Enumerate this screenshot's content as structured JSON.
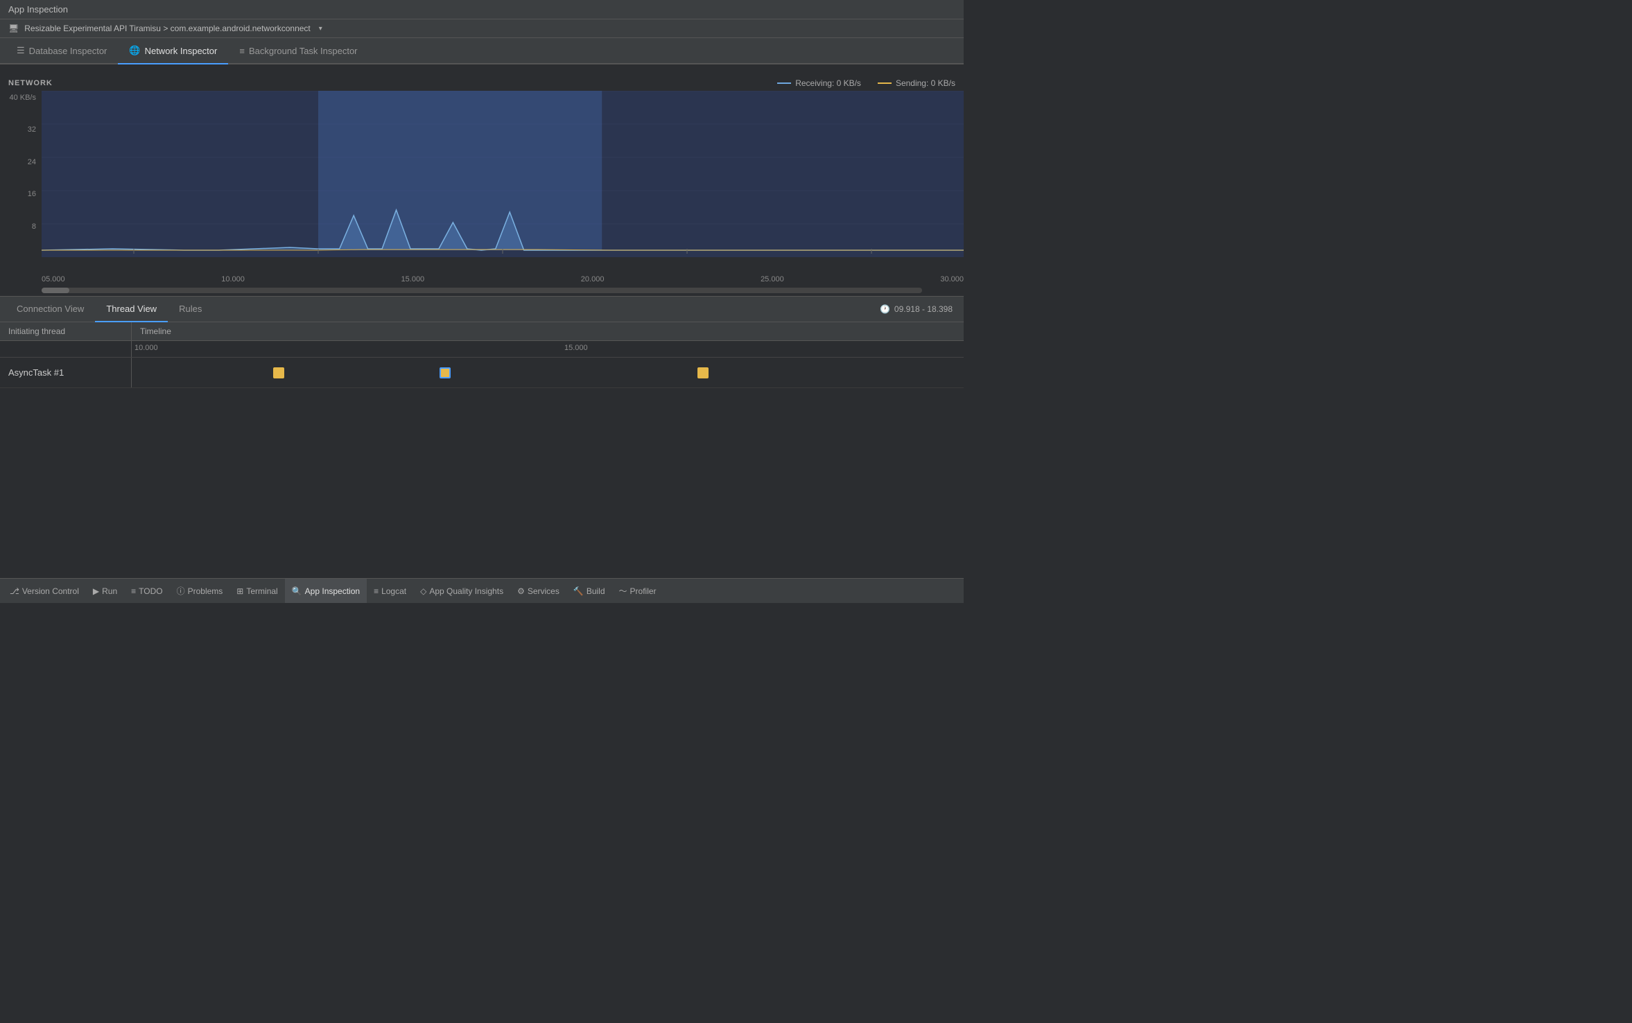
{
  "titleBar": {
    "label": "App Inspection"
  },
  "deviceBar": {
    "icon": "📱",
    "text": "Resizable Experimental API Tiramisu > com.example.android.networkconnect",
    "dropdown": "▾"
  },
  "inspectorTabs": [
    {
      "id": "database",
      "label": "Database Inspector",
      "icon": "☰",
      "active": false
    },
    {
      "id": "network",
      "label": "Network Inspector",
      "icon": "🌐",
      "active": true
    },
    {
      "id": "background",
      "label": "Background Task Inspector",
      "icon": "≡",
      "active": false
    }
  ],
  "chart": {
    "title": "NETWORK",
    "yAxisLabel": "40 KB/s",
    "yLabels": [
      "40 KB/s",
      "32",
      "24",
      "16",
      "8",
      ""
    ],
    "legend": {
      "receiving": "Receiving: 0 KB/s",
      "sending": "Sending: 0 KB/s"
    },
    "xLabels": [
      "05.000",
      "10.000",
      "15.000",
      "20.000",
      "25.000",
      "30.000"
    ],
    "selectedRange": {
      "start": "09.918",
      "end": "18.398"
    }
  },
  "viewTabs": [
    {
      "id": "connection",
      "label": "Connection View",
      "active": false
    },
    {
      "id": "thread",
      "label": "Thread View",
      "active": true
    },
    {
      "id": "rules",
      "label": "Rules",
      "active": false
    }
  ],
  "timeRange": "09.918 - 18.398",
  "threadTable": {
    "columns": [
      "Initiating thread",
      "Timeline"
    ],
    "rulerLabels": [
      {
        "label": "10.000",
        "pos": 0
      },
      {
        "label": "15.000",
        "pos": 57
      }
    ],
    "rows": [
      {
        "label": "AsyncTask #1",
        "events": [
          {
            "id": "e1",
            "pos": 17,
            "selected": false
          },
          {
            "id": "e2",
            "pos": 37,
            "selected": true
          },
          {
            "id": "e3",
            "pos": 68,
            "selected": false
          }
        ]
      }
    ]
  },
  "statusBar": {
    "items": [
      {
        "id": "version-control",
        "icon": "⎇",
        "label": "Version Control"
      },
      {
        "id": "run",
        "icon": "▶",
        "label": "Run"
      },
      {
        "id": "todo",
        "icon": "≡",
        "label": "TODO"
      },
      {
        "id": "problems",
        "icon": "ⓘ",
        "label": "Problems"
      },
      {
        "id": "terminal",
        "icon": "⊞",
        "label": "Terminal"
      },
      {
        "id": "app-inspection",
        "icon": "🔍",
        "label": "App Inspection",
        "active": true
      },
      {
        "id": "logcat",
        "icon": "≡",
        "label": "Logcat"
      },
      {
        "id": "app-quality",
        "icon": "◇",
        "label": "App Quality Insights"
      },
      {
        "id": "services",
        "icon": "⚙",
        "label": "Services"
      },
      {
        "id": "build",
        "icon": "🔨",
        "label": "Build"
      },
      {
        "id": "profiler",
        "icon": "〜",
        "label": "Profiler"
      }
    ]
  }
}
